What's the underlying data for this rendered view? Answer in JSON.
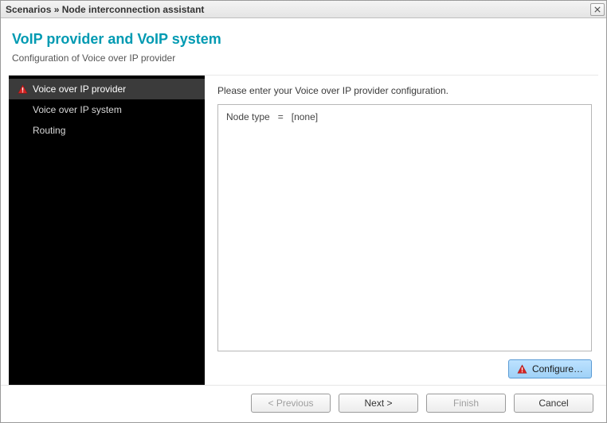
{
  "window": {
    "breadcrumb": "Scenarios » Node interconnection assistant"
  },
  "header": {
    "title": "VoIP provider and VoIP system",
    "subtitle": "Configuration of Voice over IP provider"
  },
  "sidebar": {
    "items": [
      {
        "label": "Voice over IP provider",
        "selected": true,
        "warning": true
      },
      {
        "label": "Voice over IP system",
        "selected": false,
        "warning": false
      },
      {
        "label": "Routing",
        "selected": false,
        "warning": false
      }
    ]
  },
  "content": {
    "instruction": "Please enter your Voice over IP provider configuration.",
    "config": {
      "node_type_label": "Node type",
      "equals": "=",
      "node_type_value": "[none]"
    },
    "configure_button": "Configure…"
  },
  "footer": {
    "previous": "< Previous",
    "next": "Next >",
    "finish": "Finish",
    "cancel": "Cancel"
  }
}
